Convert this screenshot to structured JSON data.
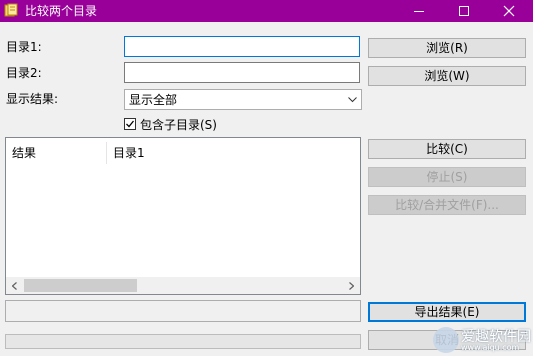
{
  "window": {
    "title": "比较两个目录",
    "title_bar_color": "#990099",
    "controls": [
      "minimize-icon",
      "maximize-icon",
      "close-icon"
    ]
  },
  "form": {
    "dir1_label": "目录1:",
    "dir1_value": "",
    "dir2_label": "目录2:",
    "dir2_value": "",
    "display_label": "显示结果:",
    "display_value": "显示全部",
    "include_subdirs_label": "包含子目录(S)",
    "include_subdirs_checked": true
  },
  "buttons": {
    "browse1": "浏览(R)",
    "browse2": "浏览(W)",
    "compare": "比较(C)",
    "stop": "停止(S)",
    "compare_merge": "比较/合并文件(F)...",
    "export": "导出结果(E)",
    "cancel": "取消"
  },
  "results": {
    "columns": [
      "结果",
      "目录1"
    ],
    "rows": []
  },
  "status": {
    "text": "",
    "progress": 0
  },
  "watermark": {
    "text": "爱趣软件园",
    "url": "www.aiqu.com"
  }
}
